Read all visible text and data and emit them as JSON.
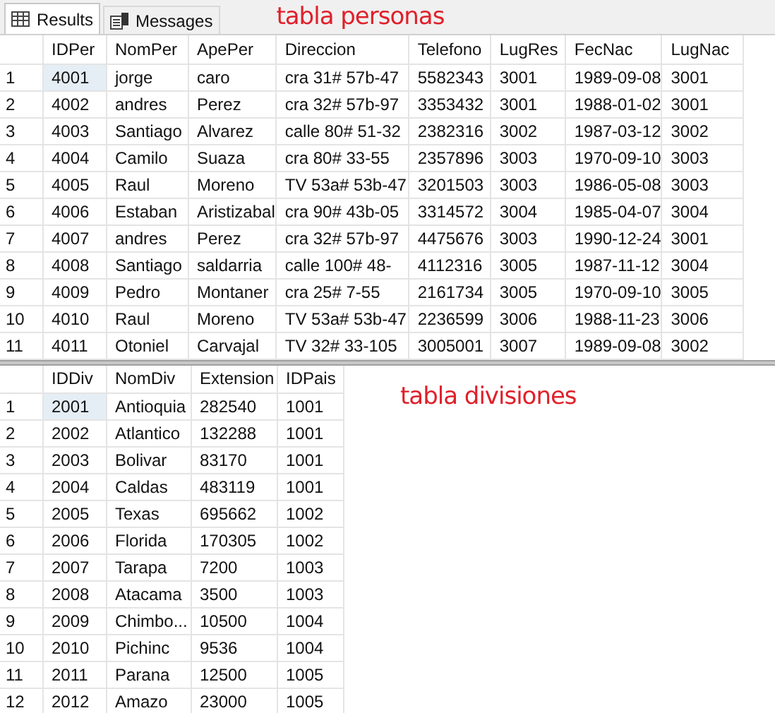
{
  "tabs": [
    {
      "label": "Results",
      "selected": true,
      "kind": "grid"
    },
    {
      "label": "Messages",
      "selected": false,
      "kind": "messages"
    }
  ],
  "note_top": "tabla personas",
  "table_1": {
    "columns": [
      "IDPer",
      "NomPer",
      "ApePer",
      "Direccion",
      "Telefono",
      "LugRes",
      "FecNac",
      "LugNac"
    ],
    "rows": [
      {
        "num": "1",
        "focused": true,
        "cells": [
          "4001",
          "jorge",
          "caro",
          "cra 31# 57b-47",
          "5582343",
          "3001",
          "1989-09-08",
          "3001"
        ]
      },
      {
        "num": "2",
        "focused": false,
        "cells": [
          "4002",
          "andres",
          "Perez",
          "cra 32# 57b-97",
          "3353432",
          "3001",
          "1988-01-02",
          "3001"
        ]
      },
      {
        "num": "3",
        "focused": false,
        "cells": [
          "4003",
          "Santiago",
          "Alvarez",
          "calle 80# 51-32",
          "2382316",
          "3002",
          "1987-03-12",
          "3002"
        ]
      },
      {
        "num": "4",
        "focused": false,
        "cells": [
          "4004",
          "Camilo",
          "Suaza",
          "cra 80# 33-55",
          "2357896",
          "3003",
          "1970-09-10",
          "3003"
        ]
      },
      {
        "num": "5",
        "focused": false,
        "cells": [
          "4005",
          "Raul",
          "Moreno",
          "TV 53a# 53b-47",
          "3201503",
          "3003",
          "1986-05-08",
          "3003"
        ]
      },
      {
        "num": "6",
        "focused": false,
        "cells": [
          "4006",
          "Estaban",
          "Aristizabal",
          "cra 90# 43b-05",
          "3314572",
          "3004",
          "1985-04-07",
          "3004"
        ]
      },
      {
        "num": "7",
        "focused": false,
        "cells": [
          "4007",
          "andres",
          "Perez",
          "cra 32# 57b-97",
          "4475676",
          "3003",
          "1990-12-24",
          "3001"
        ]
      },
      {
        "num": "8",
        "focused": false,
        "cells": [
          "4008",
          "Santiago",
          "saldarria",
          "calle 100# 48-",
          "4112316",
          "3005",
          "1987-11-12",
          "3004"
        ]
      },
      {
        "num": "9",
        "focused": false,
        "cells": [
          "4009",
          "Pedro",
          "Montaner",
          "cra 25# 7-55",
          "2161734",
          "3005",
          "1970-09-10",
          "3005"
        ]
      },
      {
        "num": "10",
        "focused": false,
        "cells": [
          "4010",
          "Raul",
          "Moreno",
          "TV 53a# 53b-47",
          "2236599",
          "3006",
          "1988-11-23",
          "3006"
        ]
      },
      {
        "num": "11",
        "focused": false,
        "cells": [
          "4011",
          "Otoniel",
          "Carvajal",
          "TV 32# 33-105",
          "3005001",
          "3007",
          "1989-09-08",
          "3002"
        ]
      }
    ]
  },
  "table_2": {
    "columns": [
      "IDDiv",
      "NomDiv",
      "Extension",
      "IDPais"
    ],
    "rows": [
      {
        "num": "1",
        "focused": true,
        "cells": [
          "2001",
          "Antioquia",
          "282540",
          "1001"
        ]
      },
      {
        "num": "2",
        "focused": false,
        "cells": [
          "2002",
          "Atlantico",
          "132288",
          "1001"
        ]
      },
      {
        "num": "3",
        "focused": false,
        "cells": [
          "2003",
          "Bolivar",
          "83170",
          "1001"
        ]
      },
      {
        "num": "4",
        "focused": false,
        "cells": [
          "2004",
          "Caldas",
          "483119",
          "1001"
        ]
      },
      {
        "num": "5",
        "focused": false,
        "cells": [
          "2005",
          "Texas",
          "695662",
          "1002"
        ]
      },
      {
        "num": "6",
        "focused": false,
        "cells": [
          "2006",
          "Florida",
          "170305",
          "1002"
        ]
      },
      {
        "num": "7",
        "focused": false,
        "cells": [
          "2007",
          "Tarapa",
          "7200",
          "1003"
        ]
      },
      {
        "num": "8",
        "focused": false,
        "cells": [
          "2008",
          "Atacama",
          "3500",
          "1003"
        ]
      },
      {
        "num": "9",
        "focused": false,
        "cells": [
          "2009",
          "Chimbo...",
          "10500",
          "1004"
        ]
      },
      {
        "num": "10",
        "focused": false,
        "cells": [
          "2010",
          "Pichinc",
          "9536",
          "1004"
        ]
      },
      {
        "num": "11",
        "focused": false,
        "cells": [
          "2011",
          "Parana",
          "12500",
          "1005"
        ]
      },
      {
        "num": "12",
        "focused": false,
        "cells": [
          "2012",
          "Amazo",
          "23000",
          "1005"
        ]
      }
    ]
  },
  "note_bottom": "tabla divisiones"
}
